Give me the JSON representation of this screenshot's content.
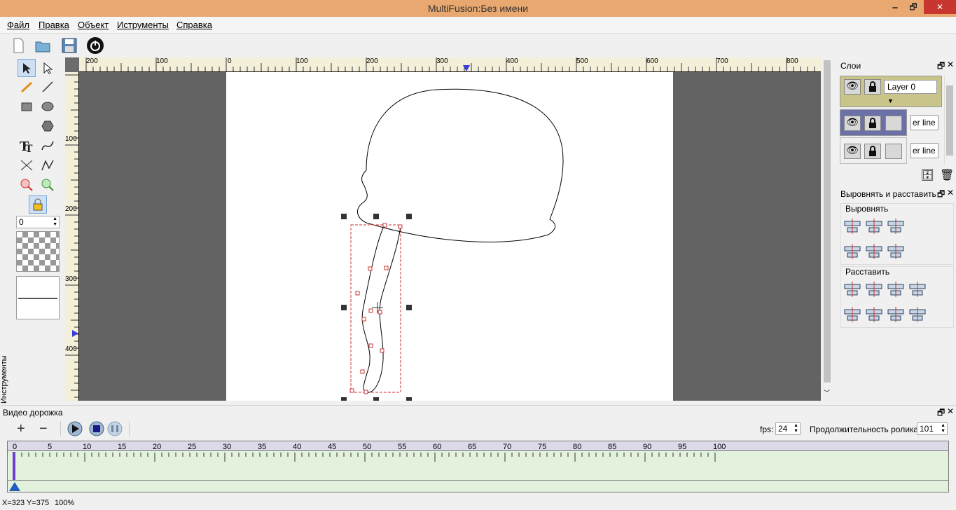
{
  "window": {
    "title": "MultiFusion:Без имени",
    "minimize": "🗕",
    "restore": "🗗",
    "close": "✕"
  },
  "menu": [
    "Файл",
    "Правка",
    "Объект",
    "Иструменты",
    "Справка"
  ],
  "toolbox": {
    "label": "Инструменты",
    "line_width": "0"
  },
  "ruler": {
    "h_labels": [
      "200",
      "100",
      "0",
      "100",
      "200",
      "300",
      "400",
      "500",
      "600",
      "700",
      "800"
    ],
    "v_labels": [
      "100",
      "200",
      "300",
      "400"
    ]
  },
  "layers": {
    "title": "Слои",
    "items": [
      {
        "name": "Layer 0"
      },
      {
        "name": "er line"
      },
      {
        "name": "er line"
      }
    ]
  },
  "align": {
    "title": "Выровнять и расставить",
    "align_label": "Выровнять",
    "distribute_label": "Расставить"
  },
  "timeline": {
    "title": "Видео дорожка",
    "fps_label": "fps:",
    "fps": "24",
    "duration_label": "Продолжительность ролика:",
    "duration": "101",
    "ticks": [
      "0",
      "5",
      "10",
      "15",
      "20",
      "25",
      "30",
      "35",
      "40",
      "45",
      "50",
      "55",
      "60",
      "65",
      "70",
      "75",
      "80",
      "85",
      "90",
      "95",
      "100"
    ]
  },
  "status": {
    "coords": "X=323  Y=375",
    "zoom": "100%"
  },
  "colors": {
    "titlebar": "#e8a86f",
    "selection": "#cc3333",
    "layer_selected": "#c8c48a",
    "layer_active": "#6b70a8"
  }
}
